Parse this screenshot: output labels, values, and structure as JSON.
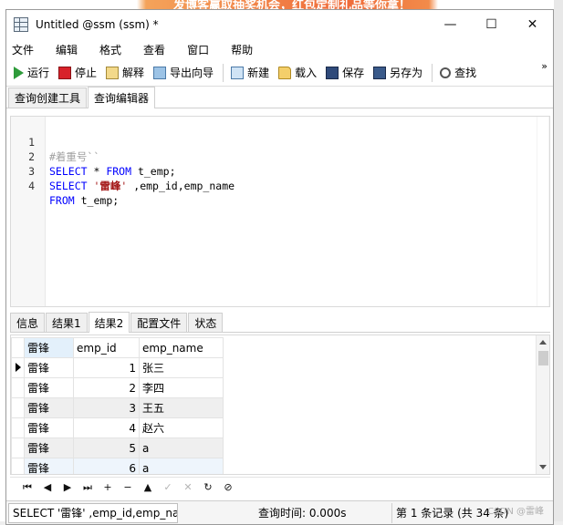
{
  "window": {
    "title": "Untitled @ssm (ssm) *",
    "minimize": "—",
    "maximize": "☐",
    "close": "✕"
  },
  "menu": [
    "文件",
    "编辑",
    "格式",
    "查看",
    "窗口",
    "帮助"
  ],
  "toolbar": {
    "run": "运行",
    "stop": "停止",
    "explain": "解释",
    "export": "导出向导",
    "new": "新建",
    "load": "载入",
    "save": "保存",
    "save_as": "另存为",
    "find": "查找",
    "more": "»"
  },
  "top_tabs": [
    "查询创建工具",
    "查询编辑器"
  ],
  "editor": {
    "lines": [
      {
        "num": "1",
        "comment": "#着重号``"
      },
      {
        "num": "2",
        "kw1": "SELECT",
        "mid": " * ",
        "kw2": "FROM",
        "rest": " t_emp;"
      },
      {
        "num": "3",
        "kw1": "SELECT",
        "str_open": " '",
        "str_text": "雷峰",
        "str_close": "'",
        "rest": " ,emp_id,emp_name"
      },
      {
        "num": "4",
        "kw1": "FROM",
        "rest": " t_emp;"
      }
    ]
  },
  "result_tabs": [
    "信息",
    "结果1",
    "结果2",
    "配置文件",
    "状态"
  ],
  "grid": {
    "columns": [
      "雷锋",
      "emp_id",
      "emp_name"
    ],
    "rows": [
      {
        "c0": "雷锋",
        "c1": "1",
        "c2": "张三"
      },
      {
        "c0": "雷锋",
        "c1": "2",
        "c2": "李四"
      },
      {
        "c0": "雷锋",
        "c1": "3",
        "c2": "王五"
      },
      {
        "c0": "雷锋",
        "c1": "4",
        "c2": "赵六"
      },
      {
        "c0": "雷锋",
        "c1": "5",
        "c2": "a"
      },
      {
        "c0": "雷锋",
        "c1": "6",
        "c2": "a"
      }
    ]
  },
  "nav": [
    "⏮",
    "◀",
    "▶",
    "⏭",
    "+",
    "−",
    "▲",
    "✓",
    "✕",
    "↻",
    "⊘"
  ],
  "status": {
    "sql": "SELECT '雷锋' ,emp_id,emp_nam",
    "time": "查询时间: 0.000s",
    "records": "第 1 条记录 (共 34 条)"
  },
  "watermark": "CSDN @雷峰",
  "banner": "发博客赢取抽奖机会，红包定制礼品等你拿！"
}
